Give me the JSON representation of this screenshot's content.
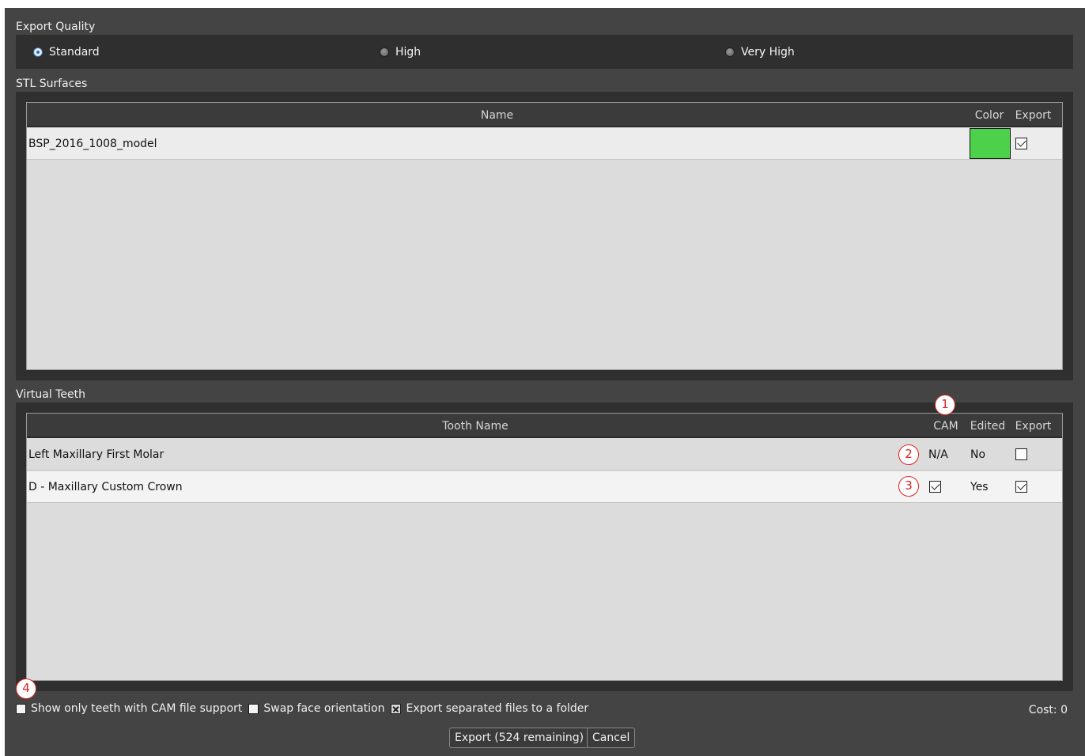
{
  "export_quality": {
    "title": "Export Quality",
    "options": [
      {
        "label": "Standard",
        "selected": true
      },
      {
        "label": "High",
        "selected": false
      },
      {
        "label": "Very High",
        "selected": false
      }
    ]
  },
  "stl_surfaces": {
    "title": "STL Surfaces",
    "columns": {
      "name": "Name",
      "color": "Color",
      "export": "Export"
    },
    "rows": [
      {
        "name": "BSP_2016_1008_model",
        "color": "#4ed14a",
        "export": true
      }
    ]
  },
  "virtual_teeth": {
    "title": "Virtual Teeth",
    "columns": {
      "tooth_name": "Tooth Name",
      "cam": "CAM",
      "edited": "Edited",
      "export": "Export"
    },
    "rows": [
      {
        "tooth_name": "Left Maxillary First Molar",
        "cam": "N/A",
        "edited": "No",
        "export": false
      },
      {
        "tooth_name": "D - Maxillary Custom Crown",
        "cam": true,
        "edited": "Yes",
        "export": true
      }
    ]
  },
  "annotations": [
    "1",
    "2",
    "3",
    "4"
  ],
  "options": {
    "show_cam_only": {
      "label": "Show only teeth with CAM file support",
      "checked": false
    },
    "swap_face": {
      "label": "Swap face orientation",
      "checked": false
    },
    "export_separated": {
      "label": "Export separated files to a folder",
      "checked": true
    }
  },
  "cost": "Cost: 0",
  "buttons": {
    "export": "Export (524 remaining)",
    "cancel": "Cancel"
  }
}
